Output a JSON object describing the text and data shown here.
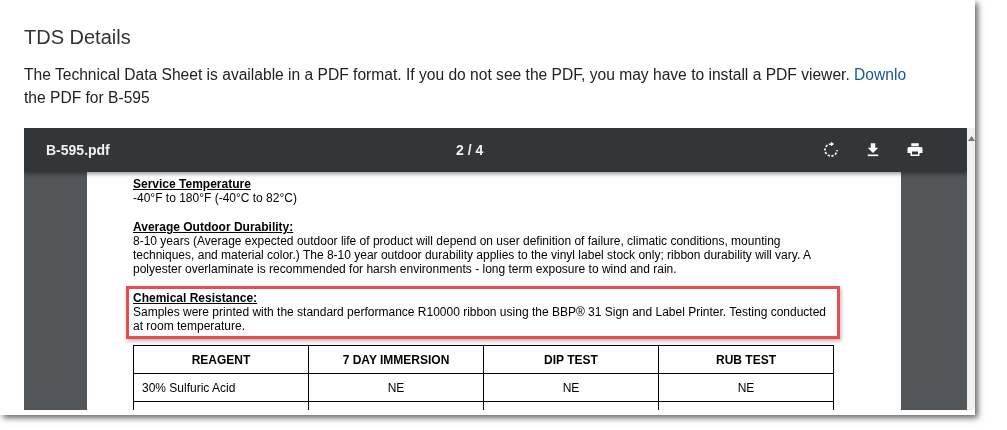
{
  "heading": "TDS Details",
  "intro": {
    "text": "The Technical Data Sheet is available in a PDF format. If you do not see the PDF, you may have to install a PDF viewer.",
    "link": "Downlo",
    "continuation": "the PDF for B-595"
  },
  "pdf_viewer": {
    "file_name": "B-595.pdf",
    "page_indicator": "2 / 4",
    "toolbar_buttons": [
      {
        "kind": "rotate"
      },
      {
        "kind": "download"
      },
      {
        "kind": "print"
      }
    ],
    "sections": [
      {
        "title": "Service Temperature",
        "lines": [
          "-40°F to 180°F (-40°C to 82°C)"
        ],
        "highlighted": false
      },
      {
        "title": "Average Outdoor Durability:",
        "lines": [
          "8-10 years (Average expected outdoor life of product will depend on user definition of failure, climatic conditions, mounting",
          "techniques, and material color.)  The 8-10 year outdoor durability applies to the vinyl label stock only; ribbon durability will vary.  A",
          "polyester overlaminate is recommended for harsh environments - long term exposure to wind and rain."
        ],
        "highlighted": false
      },
      {
        "title": "Chemical Resistance:",
        "lines": [
          "Samples were printed with the standard performance R10000 ribbon using the BBP® 31 Sign and Label Printer.  Testing conducted",
          "at room temperature."
        ],
        "highlighted": true
      }
    ],
    "table": {
      "columns": [
        "REAGENT",
        "7 DAY IMMERSION",
        "DIP TEST",
        "RUB TEST"
      ],
      "rows": [
        [
          "30% Sulfuric Acid",
          "NE",
          "NE",
          "NE"
        ]
      ]
    }
  }
}
